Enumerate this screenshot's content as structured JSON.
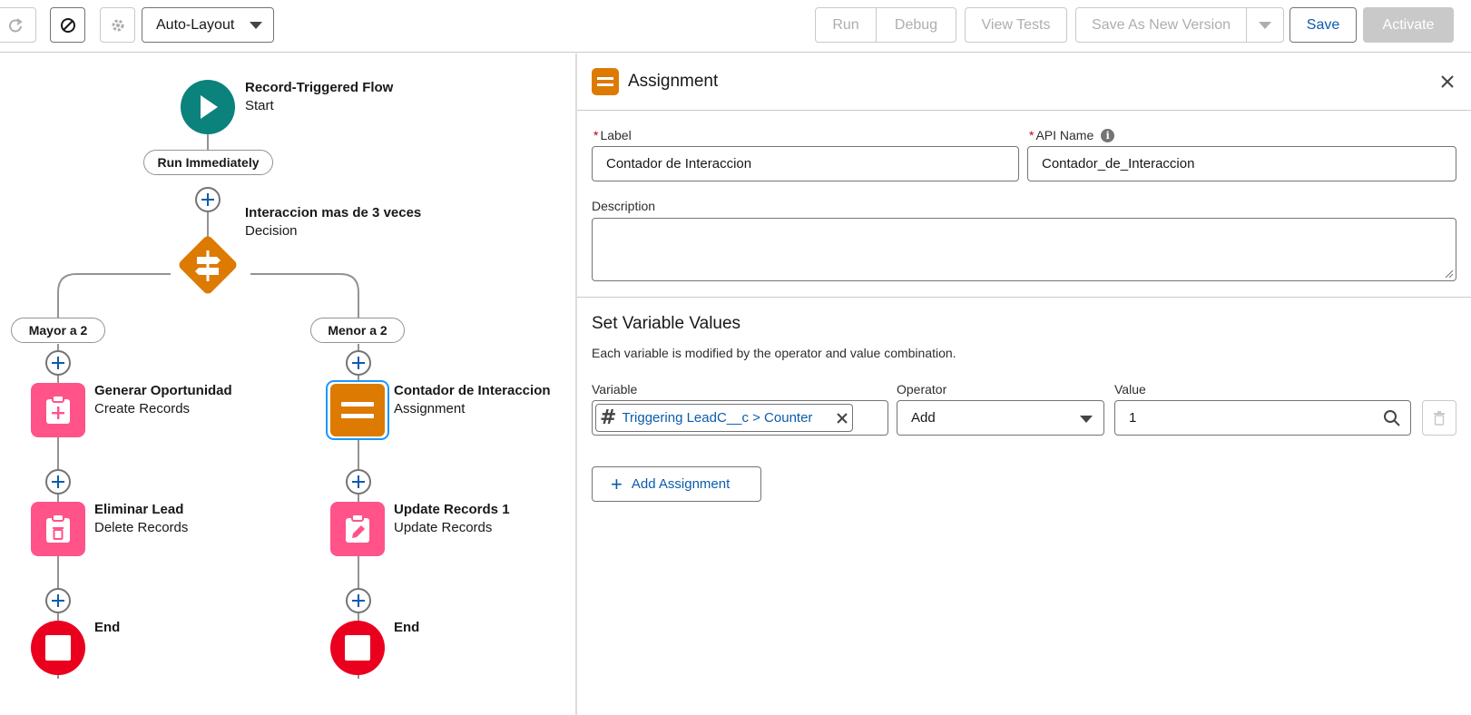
{
  "toolbar": {
    "layout_select": "Auto-Layout",
    "run_label": "Run",
    "debug_label": "Debug",
    "view_tests_label": "View Tests",
    "save_as_new_version_label": "Save As New Version",
    "save_label": "Save",
    "activate_label": "Activate"
  },
  "flow": {
    "start": {
      "title": "Record-Triggered Flow",
      "subtitle": "Start"
    },
    "run_pill": "Run Immediately",
    "decision": {
      "title": "Interaccion mas de 3 veces",
      "subtitle": "Decision"
    },
    "left_branch": {
      "label": "Mayor a 2",
      "node1": {
        "title": "Generar Oportunidad",
        "subtitle": "Create Records"
      },
      "node2": {
        "title": "Eliminar Lead",
        "subtitle": "Delete Records"
      },
      "end": "End"
    },
    "right_branch": {
      "label": "Menor a 2",
      "node1": {
        "title": "Contador de Interaccion",
        "subtitle": "Assignment"
      },
      "node2": {
        "title": "Update Records 1",
        "subtitle": "Update Records"
      },
      "end": "End"
    }
  },
  "panel": {
    "title": "Assignment",
    "required_marker": "*",
    "label_field": {
      "label": "Label",
      "value": "Contador de Interaccion"
    },
    "api_name_field": {
      "label": "API Name",
      "value": "Contador_de_Interaccion"
    },
    "description_label": "Description",
    "section_title": "Set Variable Values",
    "section_help": "Each variable is modified by the operator and value combination.",
    "columns": {
      "variable": "Variable",
      "operator": "Operator",
      "value": "Value"
    },
    "row": {
      "variable": "Triggering LeadC__c > Counter",
      "operator": "Add",
      "value": "1"
    },
    "add_assignment_label": "Add Assignment"
  },
  "colors": {
    "start": "#0b827c",
    "decision": "#dd7a01",
    "assignment": "#dd7a01",
    "record": "#ff538a",
    "end": "#ea001e",
    "link": "#0b5cab"
  }
}
